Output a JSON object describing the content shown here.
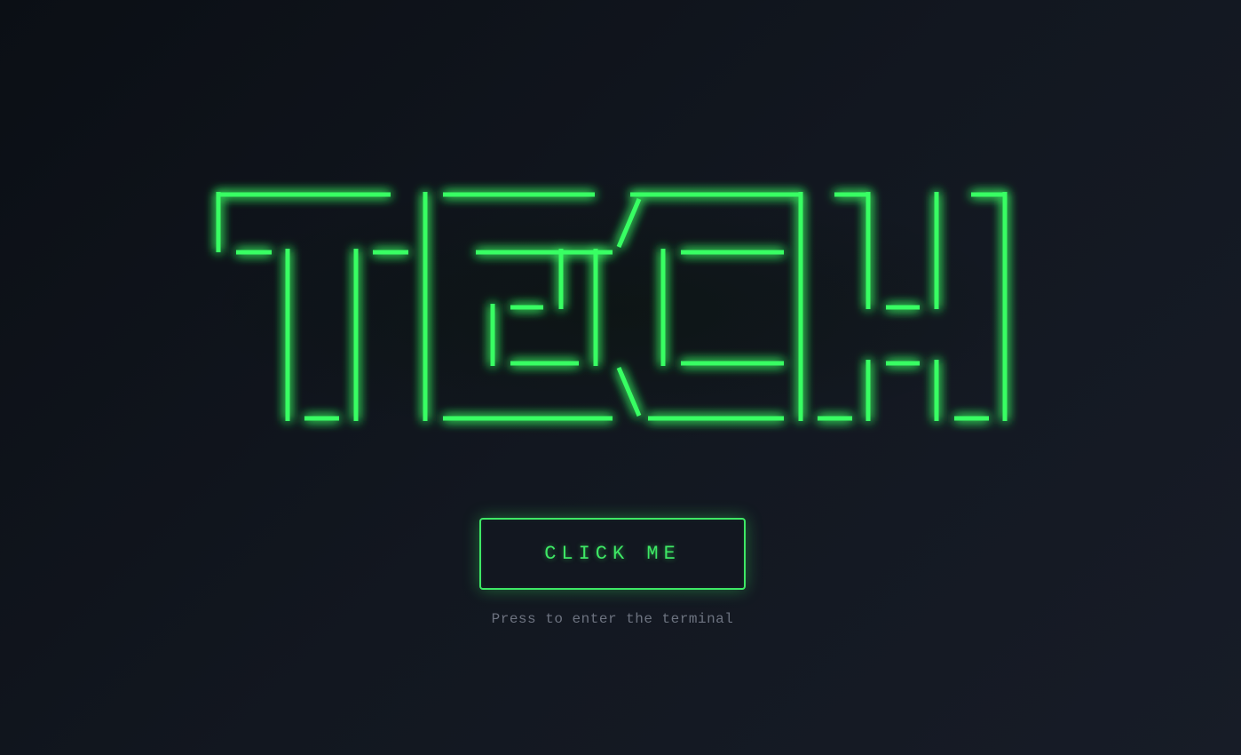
{
  "logo": {
    "text": "TECH",
    "color": "#39ff64"
  },
  "cta": {
    "label": "CLICK ME",
    "color": "#3ee865"
  },
  "hint": {
    "text": "Press to enter the terminal"
  },
  "background": {
    "from": "#0b0f15",
    "to": "#171c27"
  }
}
